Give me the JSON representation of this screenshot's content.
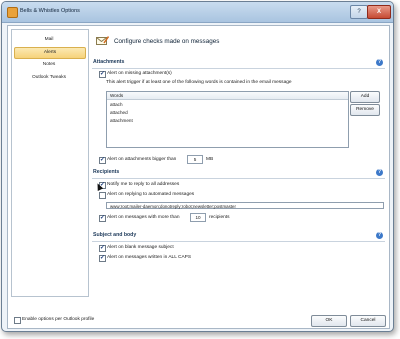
{
  "window": {
    "title": "Bells & Whistles Options",
    "help_button": "?",
    "close_button": "X"
  },
  "nav": {
    "items": [
      "Mail",
      "Alerts",
      "Notes",
      "Outlook Tweaks"
    ],
    "selected": "Alerts"
  },
  "header": {
    "title": "Configure checks made on messages"
  },
  "attachments": {
    "section_label": "Attachments",
    "help": "?",
    "missing_label": "Alert on missing attachment(s)",
    "missing_checked": true,
    "description": "This alert trigger if at least one of the following words is contained in the email message",
    "words_header": "Words",
    "words": [
      "attach",
      "attached",
      "attachment"
    ],
    "add_label": "Add",
    "remove_label": "Remove",
    "bigger_label": "Alert on attachments bigger than",
    "bigger_checked": true,
    "bigger_value": "5",
    "bigger_unit": "MB"
  },
  "recipients": {
    "section_label": "Recipients",
    "help": "?",
    "notify_all_label": "Notify me to reply to all addresses",
    "notify_all_checked": true,
    "automated_label": "Alert on replying to automated messages",
    "automated_checked": false,
    "automated_list": "www;root;mailer-daemon;donotreply;robot;newsletter;postmaster",
    "more_than_label": "Alert on messages with more than",
    "more_than_checked": true,
    "more_than_value": "10",
    "more_than_unit": "recipients"
  },
  "subject": {
    "section_label": "Subject and body",
    "help": "?",
    "blank_label": "Alert on blank message subject",
    "blank_checked": true,
    "caps_label": "Alert on messages written in ALL CAPS",
    "caps_checked": true
  },
  "footer": {
    "per_profile_label": "Enable options per Outlook profile",
    "per_profile_checked": false,
    "ok_label": "OK",
    "cancel_label": "Cancel"
  }
}
